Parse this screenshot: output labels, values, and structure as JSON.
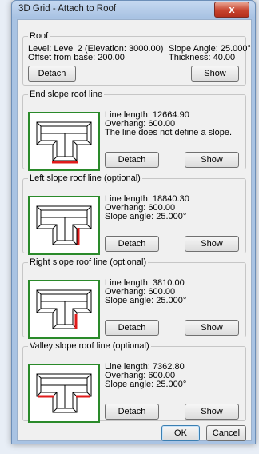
{
  "window": {
    "title": "3D Grid - Attach to Roof",
    "close_label": "x"
  },
  "roof": {
    "legend": "Roof",
    "level": "Level: Level 2  (Elevation: 3000.00)",
    "offset": "Offset from base: 200.00",
    "slope_angle": "Slope Angle: 25.000°",
    "thickness": "Thickness: 40.00",
    "detach_label": "Detach",
    "show_label": "Show"
  },
  "sections": [
    {
      "legend": "End slope roof line",
      "line1": "Line length: 12664.90",
      "line2": "Overhang: 600.00",
      "line3": "The line does not define a slope.",
      "detach_label": "Detach",
      "show_label": "Show"
    },
    {
      "legend": "Left slope roof line (optional)",
      "line1": "Line length: 18840.30",
      "line2": "Overhang: 600.00",
      "line3": "Slope angle: 25.000°",
      "detach_label": "Detach",
      "show_label": "Show"
    },
    {
      "legend": "Right slope roof line (optional)",
      "line1": "Line length: 3810.00",
      "line2": "Overhang: 600.00",
      "line3": "Slope angle: 25.000°",
      "detach_label": "Detach",
      "show_label": "Show"
    },
    {
      "legend": "Valley slope roof line (optional)",
      "line1": "Line length: 7362.80",
      "line2": "Overhang: 600.00",
      "line3": "Slope angle: 25.000°",
      "detach_label": "Detach",
      "show_label": "Show"
    }
  ],
  "footer": {
    "ok_label": "OK",
    "cancel_label": "Cancel"
  },
  "colors": {
    "highlight": "#e01b1b",
    "frame": "#2a8a2a"
  }
}
